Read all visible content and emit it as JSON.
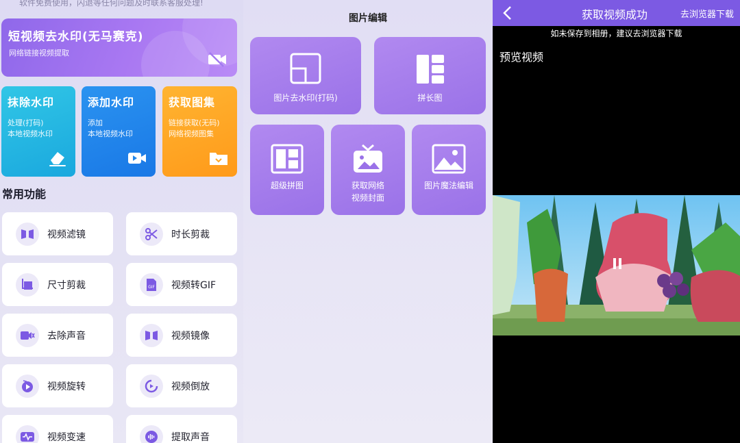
{
  "notice": "软件免费使用，闪退等任何问题及时联系客服处理!",
  "hero": {
    "title": "短视频去水印(无马赛克)",
    "subtitle": "网络链接视频提取",
    "icon": "video-off-icon"
  },
  "tiles": [
    {
      "title": "抹除水印",
      "line1": "处理(打码)",
      "line2": "本地视频水印",
      "icon": "eraser-icon",
      "color": "#1fb3e0"
    },
    {
      "title": "添加水印",
      "line1": "添加",
      "line2": "本地视频水印",
      "icon": "video-camera-icon",
      "color": "#2186ea"
    },
    {
      "title": "获取图集",
      "line1": "链接获取(无码)",
      "line2": "网络视频图集",
      "icon": "folder-icon",
      "color": "#ffa726"
    }
  ],
  "section_title": "常用功能",
  "functions": [
    {
      "label": "视频滤镜",
      "icon": "filter-icon"
    },
    {
      "label": "时长剪裁",
      "icon": "scissors-icon"
    },
    {
      "label": "尺寸剪裁",
      "icon": "crop-icon"
    },
    {
      "label": "视频转GIF",
      "icon": "gif-icon"
    },
    {
      "label": "去除声音",
      "icon": "mute-icon"
    },
    {
      "label": "视频镜像",
      "icon": "mirror-icon"
    },
    {
      "label": "视频旋转",
      "icon": "rotate-icon"
    },
    {
      "label": "视频倒放",
      "icon": "reverse-icon"
    },
    {
      "label": "视频变速",
      "icon": "speed-icon"
    },
    {
      "label": "提取声音",
      "icon": "audio-icon"
    }
  ],
  "image_edit": {
    "title": "图片编辑",
    "cards": [
      {
        "label": "图片去水印(打码)",
        "icon": "image-square-icon"
      },
      {
        "label": "拼长图",
        "icon": "long-image-icon"
      },
      {
        "label": "超级拼图",
        "icon": "collage-icon"
      },
      {
        "label": "获取网络",
        "label2": "视频封面",
        "icon": "tv-icon"
      },
      {
        "label": "图片魔法编辑",
        "icon": "landscape-icon"
      }
    ]
  },
  "player": {
    "title": "获取视频成功",
    "action": "去浏览器下载",
    "hint": "如未保存到相册，建议去浏览器下载",
    "preview_label": "预览视频",
    "accent": "#7c5ae3"
  }
}
